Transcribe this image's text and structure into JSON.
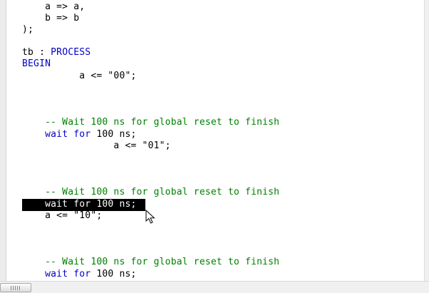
{
  "editor": {
    "lines": [
      {
        "segments": [
          {
            "text": "    a => a,",
            "kind": "text"
          }
        ]
      },
      {
        "segments": [
          {
            "text": "    b => b",
            "kind": "text"
          }
        ]
      },
      {
        "segments": [
          {
            "text": ");",
            "kind": "text"
          }
        ]
      },
      {
        "segments": [
          {
            "text": "tb : ",
            "kind": "text"
          },
          {
            "text": "PROCESS",
            "kind": "keyword"
          }
        ]
      },
      {
        "segments": [
          {
            "text": "BEGIN",
            "kind": "keyword"
          }
        ]
      },
      {
        "segments": [
          {
            "text": "          a <= \"00\";",
            "kind": "text"
          }
        ]
      },
      {
        "segments": [
          {
            "text": "    -- Wait 100 ns for global reset to finish",
            "kind": "comment"
          }
        ]
      },
      {
        "segments": [
          {
            "text": "    ",
            "kind": "text"
          },
          {
            "text": "wait for",
            "kind": "keyword"
          },
          {
            "text": " 100 ns;",
            "kind": "text"
          }
        ]
      },
      {
        "segments": [
          {
            "text": "                a <= \"01\";",
            "kind": "text"
          }
        ]
      },
      {
        "segments": [
          {
            "text": "    -- Wait 100 ns for global reset to finish",
            "kind": "comment"
          }
        ]
      },
      {
        "segments": [
          {
            "text": "    wait for 100 ns;",
            "kind": "selected"
          }
        ]
      },
      {
        "segments": [
          {
            "text": "    a <= \"10\";",
            "kind": "text"
          }
        ]
      },
      {
        "segments": [
          {
            "text": "    -- Wait 100 ns for global reset to finish",
            "kind": "comment"
          }
        ]
      },
      {
        "segments": [
          {
            "text": "    ",
            "kind": "text"
          },
          {
            "text": "wait for",
            "kind": "keyword"
          },
          {
            "text": " 100 ns;",
            "kind": "text"
          }
        ]
      }
    ]
  },
  "colors": {
    "keyword": "#0000c8",
    "comment": "#008000",
    "text": "#000000",
    "selection_bg": "#000000",
    "selection_fg": "#ffffff"
  },
  "icons": {
    "cursor": "mouse-pointer-icon",
    "scroll_grip": "scroll-grip-icon"
  }
}
